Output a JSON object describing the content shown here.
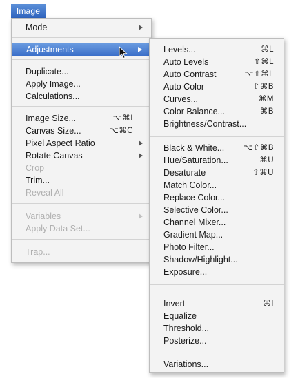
{
  "menu_title": "Image",
  "main_menu": {
    "items": [
      {
        "label": "Mode",
        "submenu": true,
        "enabled": true
      },
      {
        "label": "Adjustments",
        "submenu": true,
        "enabled": true,
        "highlighted": true
      },
      {
        "label": "Duplicate...",
        "enabled": true
      },
      {
        "label": "Apply Image...",
        "enabled": true
      },
      {
        "label": "Calculations...",
        "enabled": true
      },
      {
        "label": "Image Size...",
        "shortcut": "⌥⌘I",
        "enabled": true
      },
      {
        "label": "Canvas Size...",
        "shortcut": "⌥⌘C",
        "enabled": true
      },
      {
        "label": "Pixel Aspect Ratio",
        "submenu": true,
        "enabled": true
      },
      {
        "label": "Rotate Canvas",
        "submenu": true,
        "enabled": true
      },
      {
        "label": "Crop",
        "enabled": false
      },
      {
        "label": "Trim...",
        "enabled": true
      },
      {
        "label": "Reveal All",
        "enabled": false
      },
      {
        "label": "Variables",
        "submenu": true,
        "enabled": false
      },
      {
        "label": "Apply Data Set...",
        "enabled": false
      },
      {
        "label": "Trap...",
        "enabled": false
      }
    ]
  },
  "submenu": {
    "items": [
      {
        "label": "Levels...",
        "shortcut": "⌘L"
      },
      {
        "label": "Auto Levels",
        "shortcut": "⇧⌘L"
      },
      {
        "label": "Auto Contrast",
        "shortcut": "⌥⇧⌘L"
      },
      {
        "label": "Auto Color",
        "shortcut": "⇧⌘B"
      },
      {
        "label": "Curves...",
        "shortcut": "⌘M"
      },
      {
        "label": "Color Balance...",
        "shortcut": "⌘B"
      },
      {
        "label": "Brightness/Contrast..."
      },
      {
        "label": "Black & White...",
        "shortcut": "⌥⇧⌘B"
      },
      {
        "label": "Hue/Saturation...",
        "shortcut": "⌘U"
      },
      {
        "label": "Desaturate",
        "shortcut": "⇧⌘U"
      },
      {
        "label": "Match Color..."
      },
      {
        "label": "Replace Color..."
      },
      {
        "label": "Selective Color..."
      },
      {
        "label": "Channel Mixer..."
      },
      {
        "label": "Gradient Map..."
      },
      {
        "label": "Photo Filter..."
      },
      {
        "label": "Shadow/Highlight..."
      },
      {
        "label": "Exposure..."
      },
      {
        "label": "Invert",
        "shortcut": "⌘I"
      },
      {
        "label": "Equalize"
      },
      {
        "label": "Threshold..."
      },
      {
        "label": "Posterize..."
      },
      {
        "label": "Variations..."
      }
    ]
  },
  "colors": {
    "highlight": "#3b6fc9",
    "menu_background": "#f3f3f3",
    "disabled_text": "#b0b0b0"
  },
  "icons": {
    "submenu_arrow": "triangle-right-icon",
    "cursor": "mouse-pointer-icon"
  }
}
